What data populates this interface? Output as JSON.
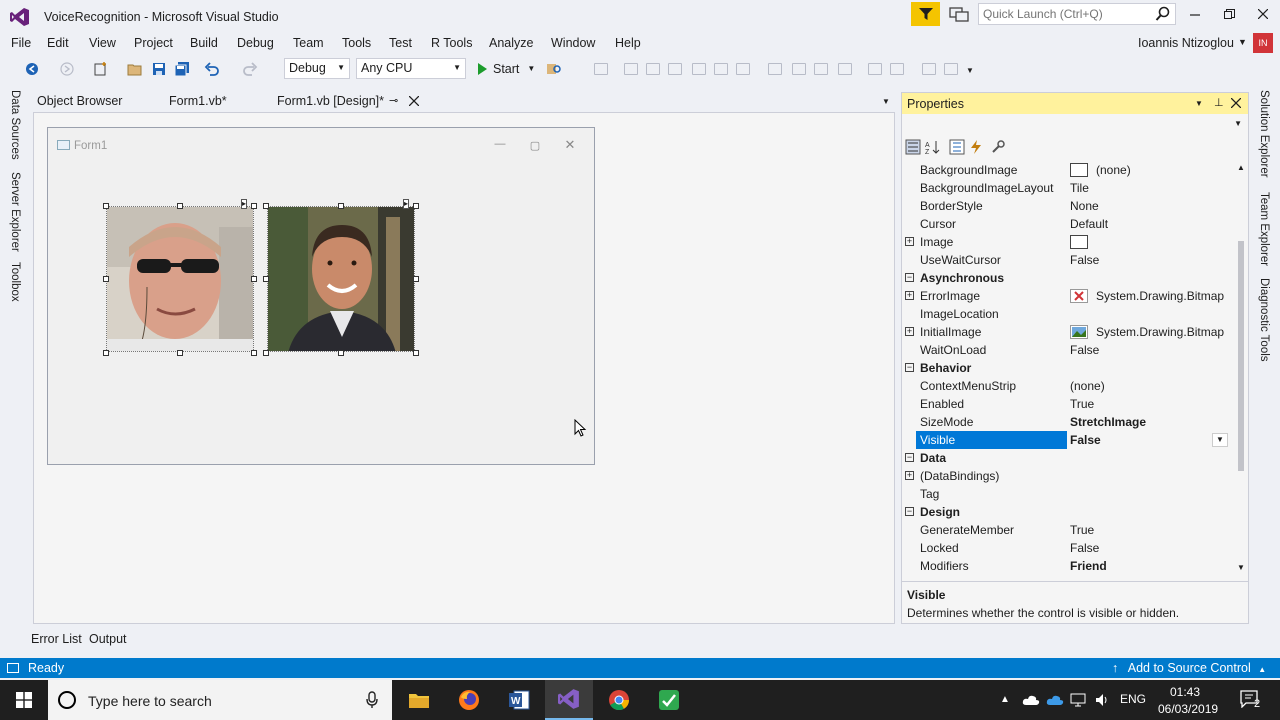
{
  "window": {
    "title": "VoiceRecognition - Microsoft Visual Studio"
  },
  "quick_launch": {
    "placeholder": "Quick Launch (Ctrl+Q)"
  },
  "menu": [
    "File",
    "Edit",
    "View",
    "Project",
    "Build",
    "Debug",
    "Team",
    "Tools",
    "Test",
    "R Tools",
    "Analyze",
    "Window",
    "Help"
  ],
  "user": {
    "name": "Ioannis Ntizoglou",
    "initials": "IN"
  },
  "toolbar": {
    "config": "Debug",
    "platform": "Any CPU",
    "start_label": "Start"
  },
  "left_tabs": [
    "Data Sources",
    "Server Explorer",
    "Toolbox"
  ],
  "doc_tabs": [
    {
      "label": "Object Browser"
    },
    {
      "label": "Form1.vb*"
    },
    {
      "label": "Form1.vb [Design]*"
    }
  ],
  "form": {
    "title": "Form1"
  },
  "bottom_tabs": [
    "Error List",
    "Output"
  ],
  "properties": {
    "title": "Properties",
    "rows": [
      {
        "name": "BackgroundImage",
        "value": "(none)",
        "swatch": true
      },
      {
        "name": "BackgroundImageLayout",
        "value": "Tile"
      },
      {
        "name": "BorderStyle",
        "value": "None"
      },
      {
        "name": "Cursor",
        "value": "Default"
      },
      {
        "name": "Image",
        "value": "",
        "swatch": true,
        "expand": true
      },
      {
        "name": "UseWaitCursor",
        "value": "False"
      },
      {
        "name": "Asynchronous",
        "category": true
      },
      {
        "name": "ErrorImage",
        "value": "System.Drawing.Bitmap",
        "expand": true,
        "img": "error"
      },
      {
        "name": "ImageLocation",
        "value": ""
      },
      {
        "name": "InitialImage",
        "value": "System.Drawing.Bitmap",
        "expand": true,
        "img": "init"
      },
      {
        "name": "WaitOnLoad",
        "value": "False"
      },
      {
        "name": "Behavior",
        "category": true
      },
      {
        "name": "ContextMenuStrip",
        "value": "(none)"
      },
      {
        "name": "Enabled",
        "value": "True"
      },
      {
        "name": "SizeMode",
        "value": "StretchImage",
        "bold": true
      },
      {
        "name": "Visible",
        "value": "False",
        "bold": true,
        "selected": true
      },
      {
        "name": "Data",
        "category": true
      },
      {
        "name": "(DataBindings)",
        "value": "",
        "expand": true
      },
      {
        "name": "Tag",
        "value": ""
      },
      {
        "name": "Design",
        "category": true
      },
      {
        "name": "GenerateMember",
        "value": "True"
      },
      {
        "name": "Locked",
        "value": "False"
      },
      {
        "name": "Modifiers",
        "value": "Friend",
        "bold": true
      }
    ],
    "desc_title": "Visible",
    "desc_text": "Determines whether the control is visible or hidden."
  },
  "right_tabs": [
    "Solution Explorer",
    "Team Explorer",
    "Diagnostic Tools"
  ],
  "status": {
    "text": "Ready",
    "source_control": "Add to Source Control"
  },
  "taskbar": {
    "search_placeholder": "Type here to search",
    "language": "ENG",
    "time": "01:43",
    "date": "06/03/2019",
    "notifications": "2"
  },
  "colors": {
    "accent": "#007acc",
    "selection": "#0078d7",
    "props_header": "#fff29d",
    "filter": "#f4c400"
  }
}
